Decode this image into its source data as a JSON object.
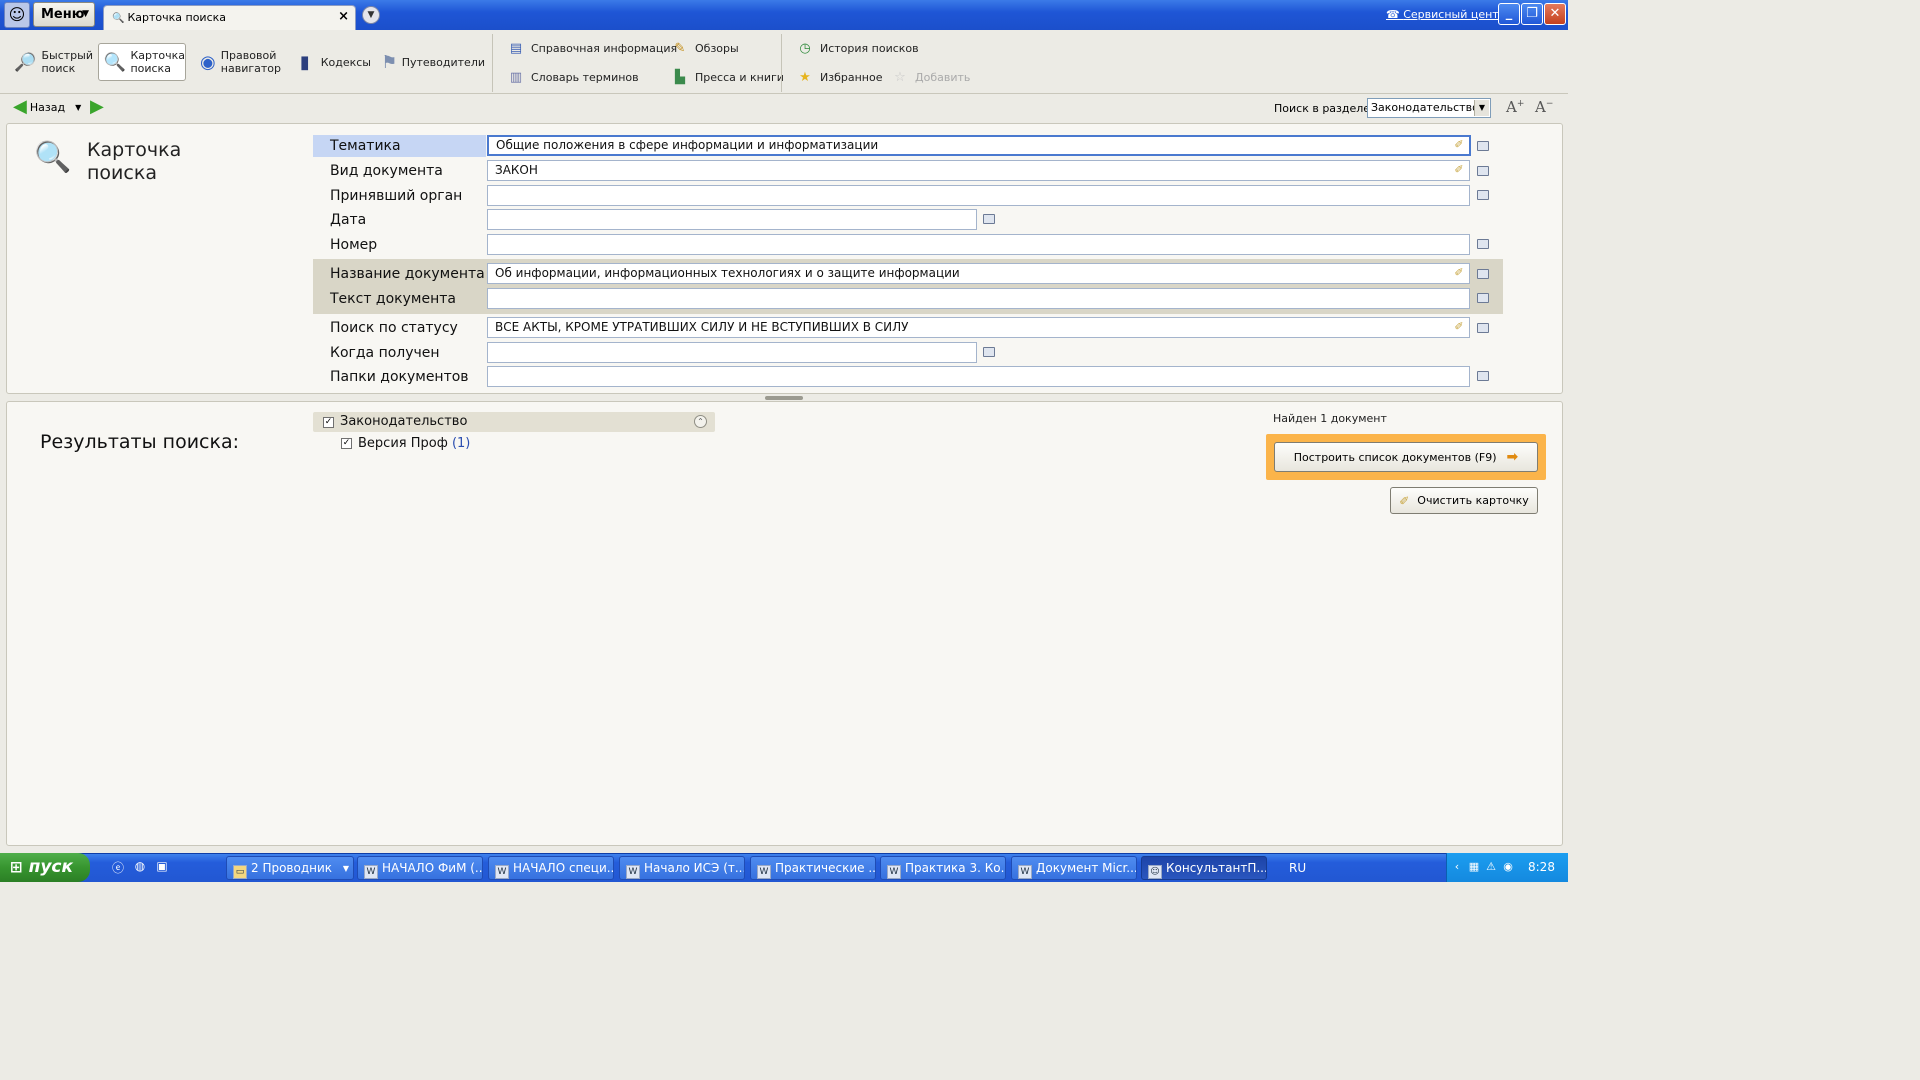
{
  "titlebar": {
    "menu_label": "Меню",
    "tab_title": "Карточка поиска",
    "service_link": "Сервисный центр"
  },
  "toolbar": {
    "main_buttons": [
      {
        "id": "quick",
        "label1": "Быстрый",
        "label2": "поиск",
        "icon": "magnifier-icon"
      },
      {
        "id": "card",
        "label1": "Карточка",
        "label2": "поиска",
        "icon": "search-card-icon",
        "active": true
      },
      {
        "id": "navigator",
        "label1": "Правовой",
        "label2": "навигатор",
        "icon": "compass-icon"
      },
      {
        "id": "codes",
        "label1": "Кодексы",
        "label2": "",
        "icon": "book-icon"
      },
      {
        "id": "guides",
        "label1": "Путеводители",
        "label2": "",
        "icon": "signpost-icon"
      }
    ],
    "info": "Справочная информация",
    "reviews": "Обзоры",
    "dictionary": "Словарь терминов",
    "press": "Пресса и книги",
    "history": "История поисков",
    "favorites": "Избранное",
    "add": "Добавить"
  },
  "nav": {
    "back": "Назад",
    "search_in_section_label": "Поиск в разделе",
    "section_value": "Законодательство"
  },
  "card": {
    "title_line1": "Карточка",
    "title_line2": "поиска",
    "fields": {
      "topic": {
        "label": "Тематика",
        "value": "Общие положения в сфере информации и информатизации"
      },
      "doc_type": {
        "label": "Вид документа",
        "value": "ЗАКОН"
      },
      "authority": {
        "label": "Принявший орган",
        "value": ""
      },
      "date": {
        "label": "Дата",
        "value": ""
      },
      "number": {
        "label": "Номер",
        "value": ""
      },
      "doc_name": {
        "label": "Название документа",
        "value": "Об информации, информационных технологиях и о защите информации"
      },
      "doc_text": {
        "label": "Текст документа",
        "value": ""
      },
      "status": {
        "label": "Поиск по статусу",
        "value": "ВСЕ АКТЫ, КРОМЕ УТРАТИВШИХ СИЛУ И НЕ ВСТУПИВШИХ В СИЛУ"
      },
      "received": {
        "label": "Когда получен",
        "value": ""
      },
      "folders": {
        "label": "Папки документов",
        "value": ""
      }
    }
  },
  "results": {
    "title": "Результаты поиска:",
    "group_label": "Законодательство",
    "sub_label": "Версия Проф",
    "sub_count": "(1)",
    "found": "Найден 1 документ",
    "build_button": "Построить список документов (F9)",
    "clear_button": "Очистить карточку"
  },
  "taskbar": {
    "start": "пуск",
    "tasks": [
      {
        "label": "2 Проводник",
        "icon": "folder-icon"
      },
      {
        "label": "НАЧАЛО ФиМ (...",
        "icon": "word-icon"
      },
      {
        "label": "НАЧАЛО специ...",
        "icon": "word-icon"
      },
      {
        "label": "Начало ИСЭ (т...",
        "icon": "word-icon"
      },
      {
        "label": "Практические ...",
        "icon": "word-icon"
      },
      {
        "label": "Практика 3. Ко...",
        "icon": "word-icon"
      },
      {
        "label": "Документ Micr...",
        "icon": "word-icon"
      },
      {
        "label": "КонсультантП...",
        "icon": "consultant-icon",
        "active": true
      }
    ],
    "lang": "RU",
    "clock": "8:28"
  }
}
